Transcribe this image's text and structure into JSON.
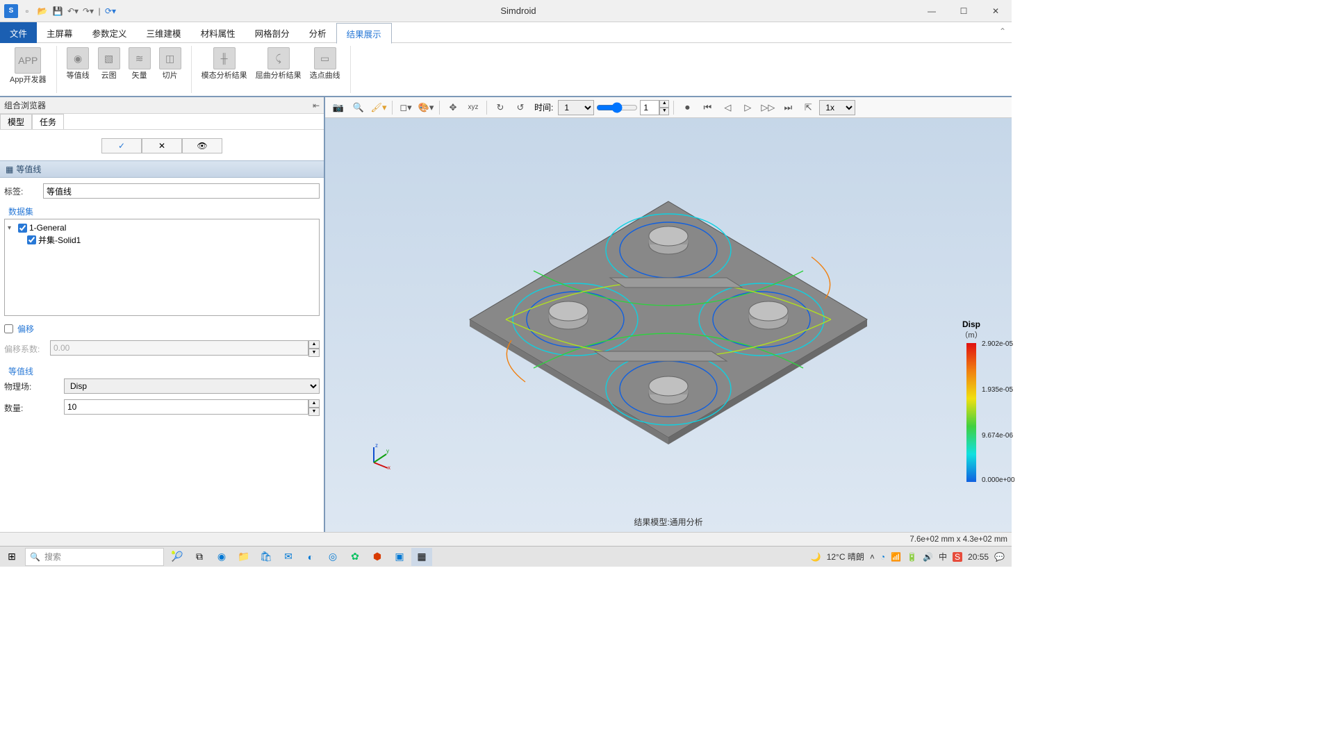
{
  "app": {
    "title": "Simdroid"
  },
  "menutabs": {
    "file": "文件",
    "items": [
      "主屏幕",
      "参数定义",
      "三维建模",
      "材料属性",
      "网格剖分",
      "分析",
      "结果展示"
    ],
    "active": 6
  },
  "ribbon": {
    "app_dev": "App开发器",
    "contour": "等值线",
    "cloud": "云图",
    "vector": "矢量",
    "slice": "切片",
    "modal": "模态分析结果",
    "buckling": "屈曲分析结果",
    "pick_curve": "选点曲线"
  },
  "leftpanel": {
    "title": "组合浏览器",
    "tab_model": "模型",
    "tab_task": "任务",
    "section": "等值线",
    "label_tag": "标签:",
    "tag_value": "等值线",
    "group_dataset": "数据集",
    "tree_item1": "1-General",
    "tree_item2": "并集-Solid1",
    "offset_chk": "偏移",
    "offset_label": "偏移系数:",
    "offset_value": "0.00",
    "group_contour": "等值线",
    "physics_label": "物理场:",
    "physics_value": "Disp",
    "count_label": "数量:",
    "count_value": "10"
  },
  "viewport": {
    "time_label": "时间:",
    "time_value": "1",
    "speed": "1x",
    "model_text": "结果模型:通用分析",
    "spin_value": "1",
    "legend": {
      "title": "Disp",
      "unit": "（m）",
      "max": "2.902e-05",
      "mid_upper": "1.935e-05",
      "mid_lower": "9.674e-06",
      "min": "0.000e+00"
    }
  },
  "statusbar": {
    "coord": "7.6e+02 mm x 4.3e+02 mm"
  },
  "taskbar": {
    "search": "搜索",
    "weather": "12°C 晴朗",
    "time": "20:55"
  }
}
